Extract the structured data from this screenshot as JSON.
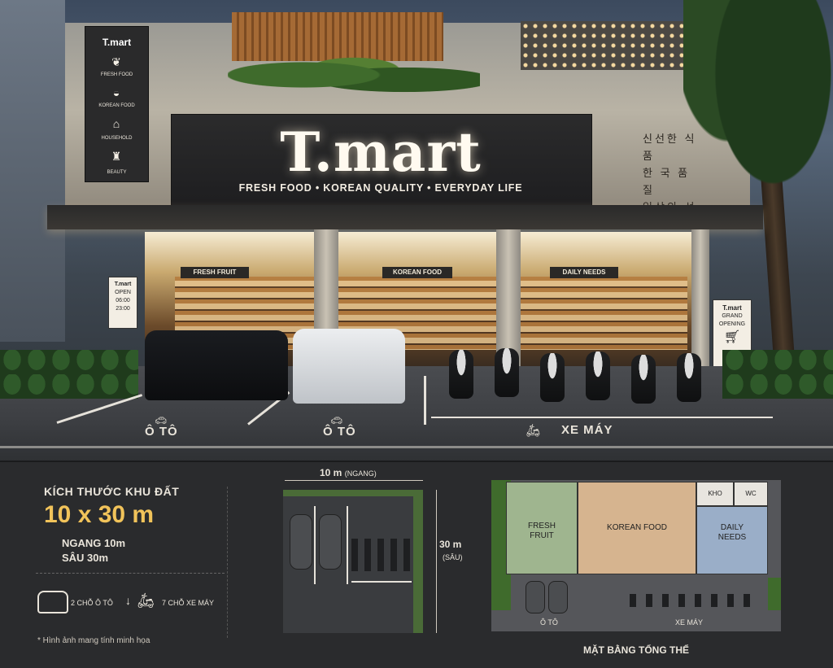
{
  "store": {
    "brand": "T.mart",
    "tagline": "FRESH FOOD • KOREAN QUALITY • EVERYDAY LIFE",
    "korean_lines": [
      "신선한 식품",
      "한 국 품 질",
      "일상의 선택"
    ]
  },
  "vertical_sign": {
    "title": "T.mart",
    "items": [
      {
        "label": "FRESH FOOD",
        "icon": "leaf-icon"
      },
      {
        "label": "KOREAN FOOD",
        "icon": "bowl-icon"
      },
      {
        "label": "HOUSEHOLD",
        "icon": "house-icon"
      },
      {
        "label": "BEAUTY",
        "icon": "bottle-icon"
      }
    ]
  },
  "zone_signs": [
    "FRESH FRUIT",
    "KOREAN FOOD",
    "DAILY NEEDS"
  ],
  "hours_board": {
    "title": "T.mart",
    "line1": "OPEN",
    "line2": "06:00",
    "line3": "23:00"
  },
  "grand_board": {
    "title": "T.mart",
    "line1": "GRAND",
    "line2": "OPENING",
    "icon": "cart-icon"
  },
  "parking_labels": {
    "car_left": "Ô TÔ",
    "car_right": "Ô TÔ",
    "moto": "XE MÁY"
  },
  "info": {
    "heading": "KÍCH THƯỚC KHU ĐẤT",
    "size": "10 x 30 m",
    "width": "NGANG 10m",
    "depth": "SÂU 30m",
    "cars": "2 CHỖ Ô TÔ",
    "motos": "7 CHỖ XE MÁY",
    "note": "* Hình ảnh mang tính minh họa"
  },
  "site_plan": {
    "top_dim": "10 m",
    "top_dim_sub": "(NGANG)",
    "side_dim": "30 m",
    "side_dim_sub": "(SÂU)"
  },
  "floor_plan": {
    "zones": {
      "fresh_fruit_1": "FRESH",
      "fresh_fruit_2": "FRUIT",
      "korean_food": "KOREAN FOOD",
      "daily_1": "DAILY",
      "daily_2": "NEEDS",
      "kho": "KHO",
      "wc": "WC"
    },
    "car_label": "Ô TÔ",
    "moto_label": "XE MÁY",
    "caption": "MẶT BẰNG TỔNG THỂ"
  },
  "colors": {
    "accent_gold": "#f1c35a",
    "fresh": "#9fb58f",
    "korean": "#d6b48f",
    "daily": "#9aaec8"
  }
}
